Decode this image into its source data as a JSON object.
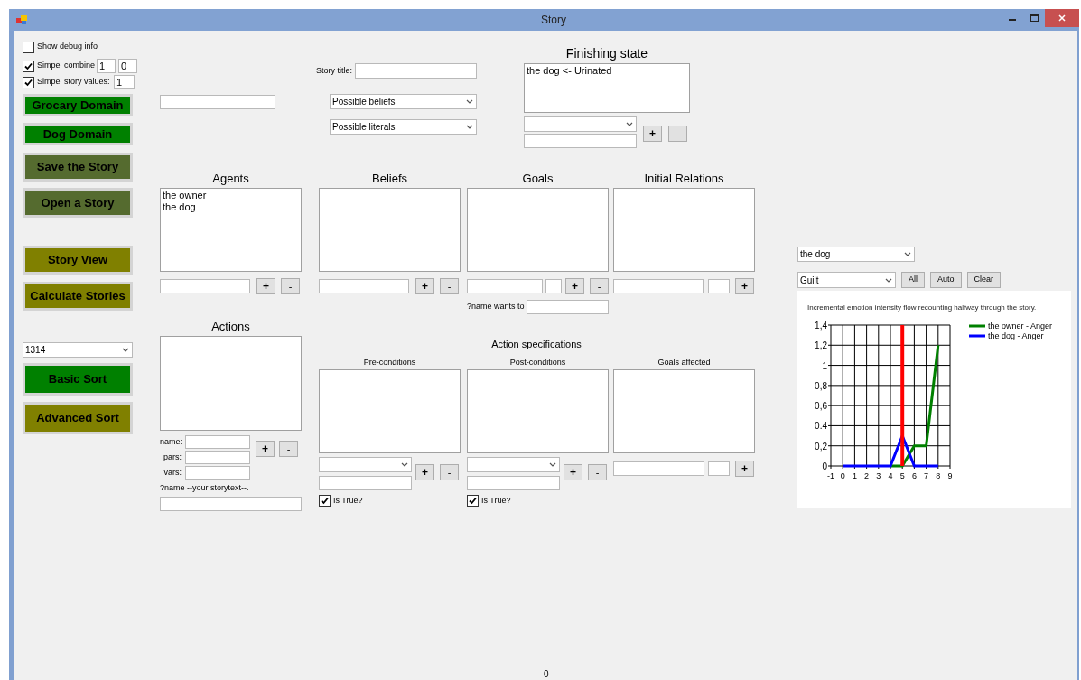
{
  "window": {
    "title": "Story"
  },
  "options": [
    {
      "label": "Show debug info",
      "checked": false
    },
    {
      "label": "Simpel combine",
      "checked": true,
      "values": [
        "1",
        "0"
      ]
    },
    {
      "label": "Simpel story values:",
      "checked": true,
      "values": [
        "1"
      ]
    }
  ],
  "side_buttons": [
    {
      "label": "Grocary Domain",
      "color": "#008000"
    },
    {
      "label": "Dog Domain",
      "color": "#008000"
    },
    {
      "label": "Save the Story",
      "color": "#556b2f"
    },
    {
      "label": "Open a Story",
      "color": "#556b2f"
    },
    {
      "label": "Story View",
      "color": "#808000"
    },
    {
      "label": "Calculate Stories",
      "color": "#808000"
    }
  ],
  "sort_select": "1314",
  "sort_buttons": [
    {
      "label": "Basic Sort",
      "color": "#008000"
    },
    {
      "label": "Advanced Sort",
      "color": "#808000"
    }
  ],
  "story_title_label": "Story title:",
  "belief_select": "Possible beliefs",
  "literal_select": "Possible literals",
  "finishing_state": {
    "title": "Finishing state",
    "items": [
      "the dog <- Urinated"
    ],
    "buttons": [
      {
        "kind": "add",
        "label": "+"
      },
      {
        "kind": "remove",
        "label": "-"
      }
    ]
  },
  "lists": [
    {
      "kind": "plain",
      "title": "Agents",
      "items": [
        "the owner",
        "the dog"
      ],
      "buttons": [
        {
          "kind": "add",
          "label": "+"
        },
        {
          "kind": "remove",
          "label": "-"
        }
      ]
    },
    {
      "kind": "plain",
      "title": "Beliefs",
      "buttons": [
        {
          "kind": "add",
          "label": "+"
        },
        {
          "kind": "remove",
          "label": "-"
        }
      ]
    },
    {
      "kind": "goal",
      "title": "Goals",
      "buttons": [
        {
          "kind": "add",
          "label": "+"
        },
        {
          "kind": "remove",
          "label": "-"
        }
      ],
      "wants_label": "?name wants to"
    },
    {
      "kind": "relation",
      "title": "Initial Relations",
      "buttons": [
        {
          "kind": "add",
          "label": "+"
        }
      ]
    }
  ],
  "actions": {
    "title": "Actions",
    "fields": [
      "name:",
      "pars:",
      "vars:"
    ],
    "buttons": [
      {
        "kind": "add",
        "label": "+"
      },
      {
        "kind": "remove",
        "label": "-"
      }
    ],
    "hint": "?name --your storytext--."
  },
  "action_specifications": {
    "title": "Action specifications",
    "columns": [
      {
        "kind": "condition",
        "title": "Pre-conditions",
        "buttons": [
          {
            "kind": "add",
            "label": "+"
          },
          {
            "kind": "remove",
            "label": "-"
          }
        ],
        "is_true": {
          "label": "Is True?",
          "checked": true
        }
      },
      {
        "kind": "condition",
        "title": "Post-conditions",
        "buttons": [
          {
            "kind": "add",
            "label": "+"
          },
          {
            "kind": "remove",
            "label": "-"
          }
        ],
        "is_true": {
          "label": "Is True?",
          "checked": true
        }
      },
      {
        "kind": "goal",
        "title": "Goals affected",
        "buttons": [
          {
            "kind": "add",
            "label": "+"
          }
        ]
      }
    ]
  },
  "emotion_panel": {
    "agent": "the dog",
    "emotion": "Guilt",
    "buttons": [
      "All",
      "Auto",
      "Clear"
    ],
    "chart_data": {
      "type": "line",
      "title": "Incremental emotion intensity flow recounting halfway through the story.",
      "x": [
        0,
        1,
        2,
        3,
        4,
        5,
        6,
        7,
        8
      ],
      "series": [
        {
          "name": "the owner - Anger",
          "color": "#008000",
          "values": [
            null,
            null,
            null,
            null,
            0,
            0,
            0.2,
            0.2,
            1.2
          ]
        },
        {
          "name": "the dog - Anger",
          "color": "#0000ff",
          "values": [
            0,
            0,
            0,
            0,
            0,
            0.3,
            0,
            0,
            0
          ]
        }
      ],
      "xlim": [
        -1,
        9
      ],
      "ylim": [
        0,
        1.4
      ],
      "xticks": [
        {
          "value": -1,
          "label": "-1"
        },
        {
          "value": 0,
          "label": "0"
        },
        {
          "value": 1,
          "label": "1"
        },
        {
          "value": 2,
          "label": "2"
        },
        {
          "value": 3,
          "label": "3"
        },
        {
          "value": 4,
          "label": "4"
        },
        {
          "value": 5,
          "label": "5"
        },
        {
          "value": 6,
          "label": "6"
        },
        {
          "value": 7,
          "label": "7"
        },
        {
          "value": 8,
          "label": "8"
        },
        {
          "value": 9,
          "label": "9"
        }
      ],
      "yticks": [
        {
          "value": 0,
          "label": "0"
        },
        {
          "value": 0.2,
          "label": "0,2"
        },
        {
          "value": 0.4,
          "label": "0.4"
        },
        {
          "value": 0.6,
          "label": "0,6"
        },
        {
          "value": 0.8,
          "label": "0,8"
        },
        {
          "value": 1,
          "label": "1"
        },
        {
          "value": 1.2,
          "label": "1,2"
        },
        {
          "value": 1.4,
          "label": "1,4"
        }
      ],
      "ref_lines": [
        {
          "axis": "x",
          "value": 5,
          "color": "#ff0000"
        }
      ],
      "grid": true,
      "legend": true
    }
  },
  "status": "0"
}
